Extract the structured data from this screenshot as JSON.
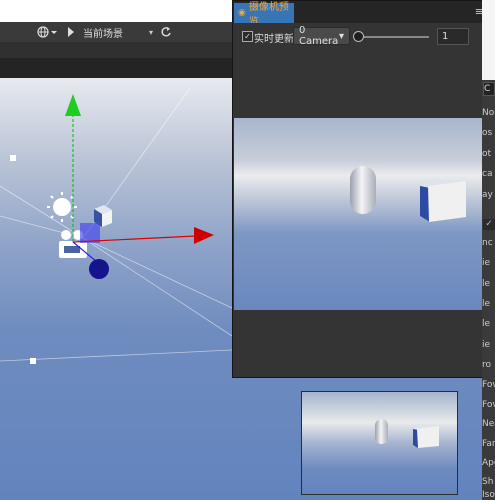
{
  "toolbar": {
    "scene_label": "当前场景",
    "scene_arrow": "▾",
    "globe_icon": "globe-icon",
    "play_icon": "play-icon",
    "refresh_icon": "refresh-icon"
  },
  "preview_panel": {
    "tab_label": "摄像机预览",
    "menu_icon": "≡",
    "realtime_label": "实时更新",
    "realtime_checked": true,
    "realtime_mark": "✓",
    "camera_select": "0 Camera",
    "camera_arrow": "▾",
    "zoom_value": "1",
    "zoom_fraction": 0.0
  },
  "props_labels": [
    "No",
    "os",
    "ot",
    "ca",
    "ay",
    "nc",
    "ie",
    "le",
    "le",
    "le",
    "ie",
    "ro",
    "Fov",
    "Fov",
    "Nea",
    "Far",
    "Ape",
    "Sh",
    "Iso"
  ],
  "props_tab": "C",
  "colors": {
    "accent_tab": "#3875b5",
    "tab_text": "#f0a640",
    "gizmo_x": "#cc0000",
    "gizmo_y": "#00bb00",
    "gizmo_z": "#2222ee"
  }
}
